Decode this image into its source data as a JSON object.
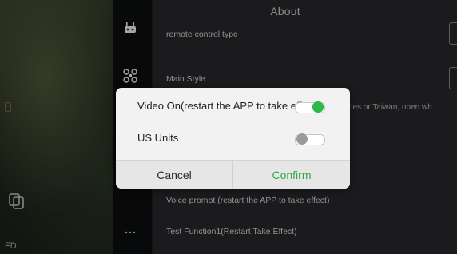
{
  "background": {
    "bottom_left_label": "FD"
  },
  "panel": {
    "title": "About",
    "rows": [
      {
        "label": "remote control type",
        "icon": "remote-controller-icon"
      },
      {
        "label": "Main Style",
        "icon": "drone-icon"
      },
      {
        "label": "Voice prompt (restart the APP to take effect)",
        "icon": ""
      },
      {
        "label": "Test Function1(Restart Take Effect)",
        "icon": "more-dots-icon"
      }
    ],
    "partial_text": "untries or Taiwan, open wh"
  },
  "dialog": {
    "options": [
      {
        "label": "Video On(restart the APP to take effect)",
        "enabled": true
      },
      {
        "label": "US Units",
        "enabled": false
      }
    ],
    "cancel_label": "Cancel",
    "confirm_label": "Confirm"
  },
  "colors": {
    "accent": "#2fb84a",
    "panel_bg": "#0e0e10",
    "dialog_bg": "#f2f2f2"
  }
}
